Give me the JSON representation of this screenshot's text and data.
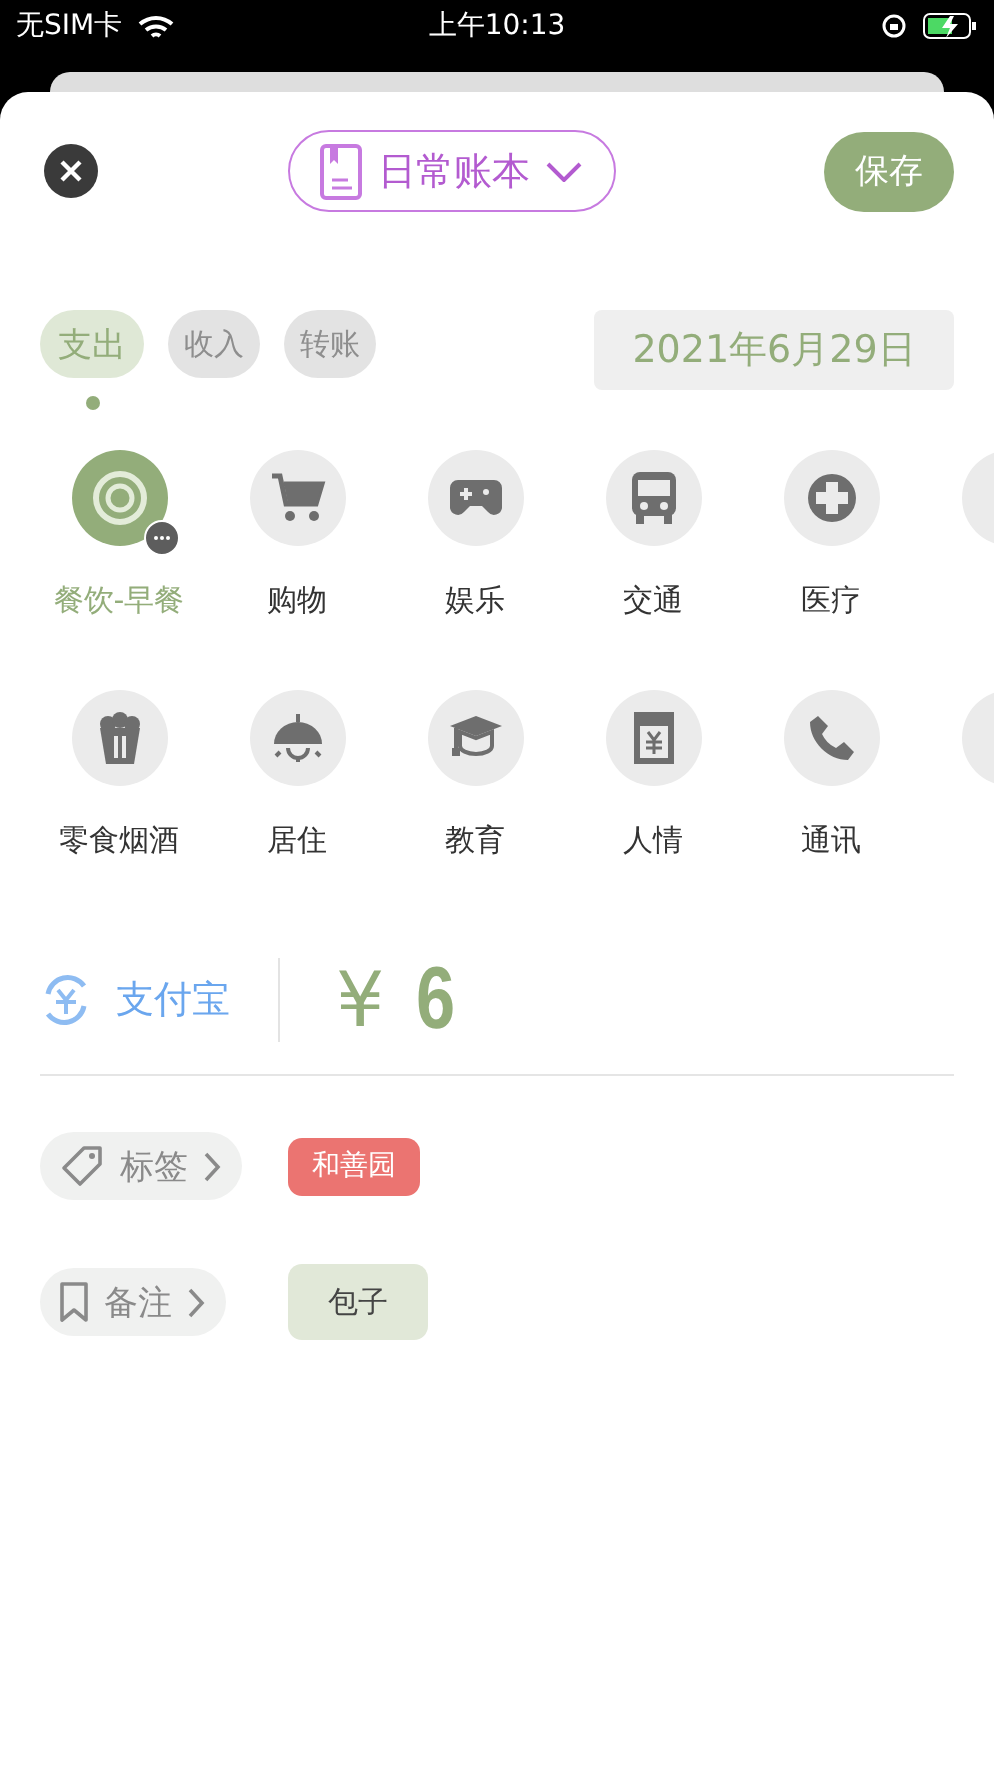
{
  "status_bar": {
    "carrier": "无SIM卡",
    "time": "上午10:13"
  },
  "header": {
    "book": "日常账本",
    "save": "保存"
  },
  "types": [
    {
      "label": "支出",
      "selected": true
    },
    {
      "label": "收入",
      "selected": false
    },
    {
      "label": "转账",
      "selected": false
    }
  ],
  "date": "2021年6月29日",
  "category_rows": [
    [
      {
        "label": "餐饮-早餐",
        "selected": true
      },
      {
        "label": "购物",
        "selected": false
      },
      {
        "label": "娱乐",
        "selected": false
      },
      {
        "label": "交通",
        "selected": false
      },
      {
        "label": "医疗",
        "selected": false
      },
      {
        "selected": false
      }
    ],
    [
      {
        "label": "零食烟酒",
        "selected": false
      },
      {
        "label": "居住",
        "selected": false
      },
      {
        "label": "教育",
        "selected": false
      },
      {
        "label": "人情",
        "selected": false
      },
      {
        "label": "通讯",
        "selected": false
      },
      {
        "selected": false
      }
    ]
  ],
  "account": {
    "name": "支付宝",
    "currency": "¥",
    "amount": "6"
  },
  "tags": {
    "label": "标签",
    "items": [
      {
        "text": "和善园",
        "color": "#eb7471"
      }
    ]
  },
  "note": {
    "label": "备注",
    "text": "包子"
  }
}
